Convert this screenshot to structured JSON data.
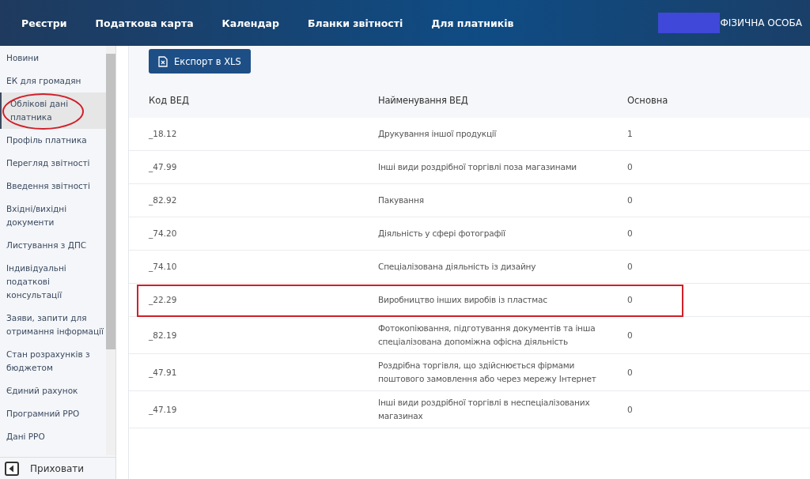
{
  "nav": {
    "items": [
      "Реєстри",
      "Податкова карта",
      "Календар",
      "Бланки звітності",
      "Для платників"
    ],
    "user_type": "ФІЗИЧНА ОСОБА"
  },
  "sidebar": {
    "items": [
      {
        "label": "Новини",
        "selected": false,
        "annotated": false
      },
      {
        "label": "ЕК для громадян",
        "selected": false,
        "annotated": false
      },
      {
        "label": "Облікові дані платника",
        "selected": true,
        "annotated": true
      },
      {
        "label": "Профіль платника",
        "selected": false,
        "annotated": false
      },
      {
        "label": "Перегляд звітності",
        "selected": false,
        "annotated": false
      },
      {
        "label": "Введення звітності",
        "selected": false,
        "annotated": false
      },
      {
        "label": "Вхідні/вихідні документи",
        "selected": false,
        "annotated": false
      },
      {
        "label": "Листування з ДПС",
        "selected": false,
        "annotated": false
      },
      {
        "label": "Індивідуальні податкові консультації",
        "selected": false,
        "annotated": false
      },
      {
        "label": "Заяви, запити для отримання інформації",
        "selected": false,
        "annotated": false
      },
      {
        "label": "Стан розрахунків з бюджетом",
        "selected": false,
        "annotated": false
      },
      {
        "label": "Єдиний рахунок",
        "selected": false,
        "annotated": false
      },
      {
        "label": "Програмний РРО",
        "selected": false,
        "annotated": false
      },
      {
        "label": "Дані РРО",
        "selected": false,
        "annotated": false
      }
    ],
    "hide_button": "Приховати"
  },
  "export_button": "Експорт в XLS",
  "table": {
    "columns": [
      "Код ВЕД",
      "Найменування ВЕД",
      "Основна"
    ],
    "rows": [
      {
        "code": "_18.12",
        "name": "Друкування іншої продукції",
        "main": "1",
        "annotated": false
      },
      {
        "code": "_47.99",
        "name": "Інші види роздрібної торгівлі поза магазинами",
        "main": "0",
        "annotated": false
      },
      {
        "code": "_82.92",
        "name": "Пакування",
        "main": "0",
        "annotated": false
      },
      {
        "code": "_74.20",
        "name": "Діяльність у сфері фотографії",
        "main": "0",
        "annotated": false
      },
      {
        "code": "_74.10",
        "name": "Спеціалізована діяльність із дизайну",
        "main": "0",
        "annotated": false
      },
      {
        "code": "_22.29",
        "name": "Виробництво інших виробів із пластмас",
        "main": "0",
        "annotated": true
      },
      {
        "code": "_82.19",
        "name": "Фотокопіювання, підготування документів та інша спеціалізована допоміжна офісна діяльність",
        "main": "0",
        "annotated": false
      },
      {
        "code": "_47.91",
        "name": "Роздрібна торгівля, що здійснюється фірмами поштового замовлення або через мережу Інтернет",
        "main": "0",
        "annotated": false
      },
      {
        "code": "_47.19",
        "name": "Інші види роздрібної торгівлі в неспеціалізованих магазинах",
        "main": "0",
        "annotated": false
      }
    ]
  }
}
